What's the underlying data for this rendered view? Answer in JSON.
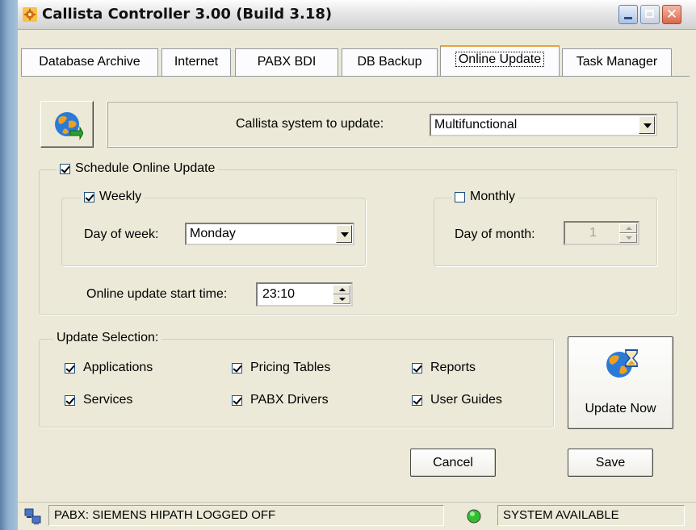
{
  "window": {
    "title": "Callista Controller 3.00 (Build 3.18)"
  },
  "tabs": [
    {
      "label": "Database Archive",
      "active": false
    },
    {
      "label": "Internet",
      "active": false
    },
    {
      "label": "PABX BDI",
      "active": false
    },
    {
      "label": "DB Backup",
      "active": false
    },
    {
      "label": "Online Update",
      "active": true
    },
    {
      "label": "Task Manager",
      "active": false
    }
  ],
  "system_select": {
    "label": "Callista system to update:",
    "value": "Multifunctional"
  },
  "schedule": {
    "label": "Schedule Online Update",
    "checked": true,
    "weekly": {
      "label": "Weekly",
      "checked": true,
      "day_label": "Day of week:",
      "day_value": "Monday"
    },
    "monthly": {
      "label": "Monthly",
      "checked": false,
      "day_label": "Day of month:",
      "day_value": "1"
    },
    "start_time_label": "Online update start time:",
    "start_time_value": "23:10"
  },
  "update_selection": {
    "label": "Update Selection:",
    "items": [
      {
        "label": "Applications",
        "checked": true
      },
      {
        "label": "Pricing Tables",
        "checked": true
      },
      {
        "label": "Reports",
        "checked": true
      },
      {
        "label": "Services",
        "checked": true
      },
      {
        "label": "PABX Drivers",
        "checked": true
      },
      {
        "label": "User Guides",
        "checked": true
      }
    ],
    "update_now_label": "Update Now"
  },
  "buttons": {
    "cancel": "Cancel",
    "save": "Save"
  },
  "status_bar": {
    "pabx_text": "PABX: SIEMENS HIPATH  LOGGED OFF",
    "system_text": "SYSTEM AVAILABLE",
    "system_led_color": "#2fbf2f"
  },
  "icons": {
    "app": "gear-flame-icon",
    "globe_update": "globe-arrow-icon",
    "globe_hourglass": "globe-hourglass-icon",
    "network": "network-computers-icon"
  }
}
